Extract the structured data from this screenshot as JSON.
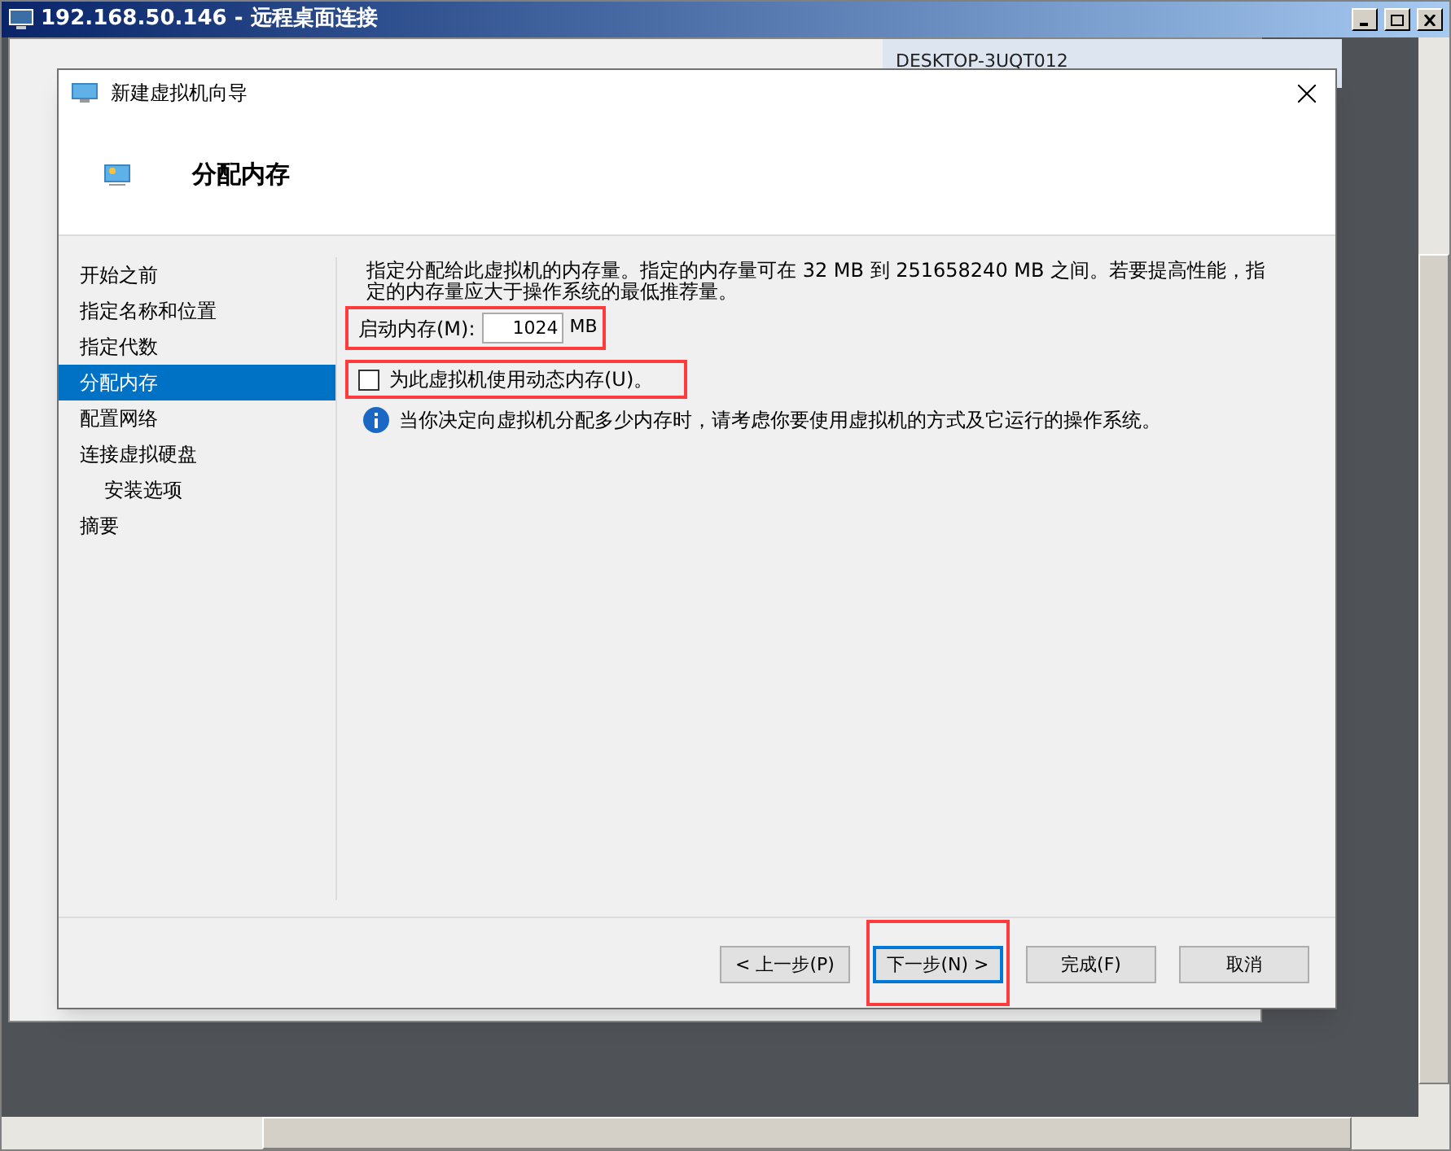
{
  "window": {
    "title": "192.168.50.146 - 远程桌面连接"
  },
  "background_window": {
    "server": "DESKTOP-3UQT012"
  },
  "dialog": {
    "title": "新建虚拟机向导",
    "heading": "分配内存",
    "steps": [
      {
        "label": "开始之前",
        "selected": false
      },
      {
        "label": "指定名称和位置",
        "selected": false
      },
      {
        "label": "指定代数",
        "selected": false
      },
      {
        "label": "分配内存",
        "selected": true
      },
      {
        "label": "配置网络",
        "selected": false
      },
      {
        "label": "连接虚拟硬盘",
        "selected": false,
        "children": [
          {
            "label": "安装选项",
            "selected": false
          }
        ]
      },
      {
        "label": "摘要",
        "selected": false
      }
    ],
    "description": "指定分配给此虚拟机的内存量。指定的内存量可在 32 MB 到 251658240 MB 之间。若要提高性能，指定的内存量应大于操作系统的最低推荐量。",
    "startup_memory": {
      "label": "启动内存(M):",
      "value": "1024",
      "unit": "MB",
      "highlighted": true
    },
    "dynamic_memory": {
      "label": "为此虚拟机使用动态内存(U)。",
      "checked": false,
      "highlighted": true
    },
    "info": "当你决定向虚拟机分配多少内存时，请考虑你要使用虚拟机的方式及它运行的操作系统。",
    "buttons": [
      {
        "label": "< 上一步(P)",
        "focused": false,
        "highlighted": false
      },
      {
        "label": "下一步(N) >",
        "focused": true,
        "highlighted": true
      },
      {
        "label": "完成(F)",
        "focused": false,
        "highlighted": false
      },
      {
        "label": "取消",
        "focused": false,
        "highlighted": false
      }
    ]
  }
}
